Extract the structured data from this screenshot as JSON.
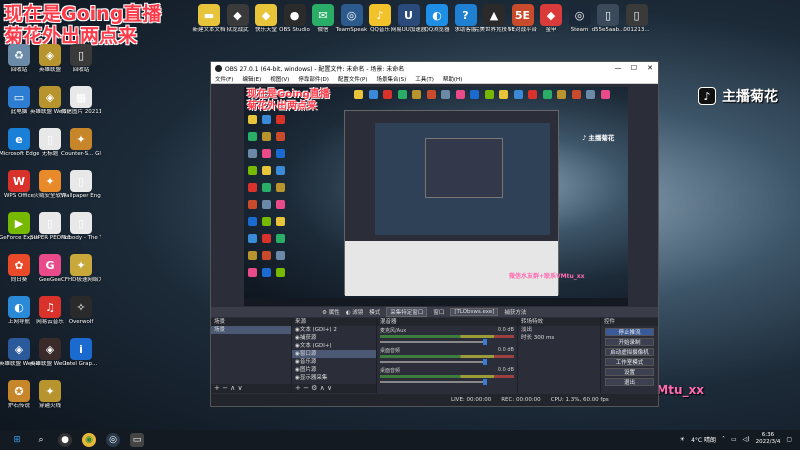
{
  "overlay": {
    "title_line1": "现在是Going直播",
    "title_line2": "菊花外出两点来",
    "tiktok_glyph": "♪",
    "streamer_name": "主播菊花",
    "wechat_text": "微信水友群+联系VMtu_xx"
  },
  "desktop_top_icons": [
    {
      "label": "新建文本文档",
      "color": "#e8c43a",
      "icon": "folder-icon"
    },
    {
      "label": "狱龙战武",
      "color": "#3a3a3a",
      "icon": "game-icon"
    },
    {
      "label": "快乐天堂",
      "color": "#e8c43a",
      "icon": "game-icon"
    },
    {
      "label": "OBS Studio",
      "color": "#2b2b2b",
      "icon": "obs-icon"
    },
    {
      "label": "微信",
      "color": "#2aae67",
      "icon": "wechat-icon"
    },
    {
      "label": "TeamSpeak",
      "color": "#2d5a8c",
      "icon": "teamspeak-icon"
    },
    {
      "label": "QQ音乐",
      "color": "#f2c22b",
      "icon": "qqmusic-icon"
    },
    {
      "label": "网易UU加速器",
      "color": "#2b4a7c",
      "icon": "uu-icon"
    },
    {
      "label": "QQ浏览器",
      "color": "#1f8fe5",
      "icon": "browser-icon"
    },
    {
      "label": "求助客服",
      "color": "#1f7fd0",
      "icon": "help-icon"
    },
    {
      "label": "完美世界竞技平台",
      "color": "#2a2a2a",
      "icon": "perfect-icon"
    },
    {
      "label": "5E对战平台",
      "color": "#c94b2c",
      "icon": "5e-icon"
    },
    {
      "label": "金甲",
      "color": "#d93a3a",
      "icon": "game-icon"
    },
    {
      "label": "Steam",
      "color": "#1b2838",
      "icon": "steam-icon"
    },
    {
      "label": "d55e5aab...",
      "color": "#3a4a5a",
      "icon": "file-icon"
    },
    {
      "label": "001213...",
      "color": "#3a3a3a",
      "icon": "file-icon"
    }
  ],
  "desktop_left_icons": [
    {
      "label": "回收站",
      "color": "#6a8aa8",
      "icon": "recycle-bin-icon"
    },
    {
      "label": "英雄联盟",
      "color": "#b8942e",
      "icon": "lol-icon"
    },
    {
      "label": "回收站",
      "color": "#3a3a3a",
      "icon": "file-icon"
    },
    {
      "label": "此电脑",
      "color": "#2d7dd2",
      "icon": "computer-icon"
    },
    {
      "label": "英雄联盟 WeGame版",
      "color": "#b8942e",
      "icon": "lol-icon"
    },
    {
      "label": "微信图片 2021121...",
      "color": "#e8e8e8",
      "icon": "image-icon"
    },
    {
      "label": "Microsoft Edge",
      "color": "#1a7fd6",
      "icon": "edge-icon"
    },
    {
      "label": "无标题",
      "color": "#e8e8e8",
      "icon": "file-icon"
    },
    {
      "label": "Counter-S... Global Off...",
      "color": "#c8862a",
      "icon": "csgo-icon"
    },
    {
      "label": "WPS Office",
      "color": "#d8322a",
      "icon": "wps-icon"
    },
    {
      "label": "火绒安全软件",
      "color": "#e88a2a",
      "icon": "huorong-icon"
    },
    {
      "label": "Wallpaper Engine:...",
      "color": "#e8e8e8",
      "icon": "file-icon"
    },
    {
      "label": "GeForce Experience",
      "color": "#76b900",
      "icon": "geforce-icon"
    },
    {
      "label": "SUPER PEOPLE CBT",
      "color": "#e8e8e8",
      "icon": "file-icon"
    },
    {
      "label": "Nobody - The Turna...",
      "color": "#e8e8e8",
      "icon": "file-icon"
    },
    {
      "label": "向日葵",
      "color": "#e84a2a",
      "icon": "sunflower-icon"
    },
    {
      "label": "GeeGee",
      "color": "#e84a8a",
      "icon": "geegee-icon"
    },
    {
      "label": "CFHD极速网络大区",
      "color": "#c8a83a",
      "icon": "cf-icon"
    },
    {
      "label": "上网导航",
      "color": "#2a8ad8",
      "icon": "nav-icon"
    },
    {
      "label": "网易云音乐",
      "color": "#d8322a",
      "icon": "netease-icon"
    },
    {
      "label": "Overwolf",
      "color": "#2a2a2a",
      "icon": "overwolf-icon"
    },
    {
      "label": "英雄联盟 WeGame版",
      "color": "#2a5a9a",
      "icon": "lol-icon"
    },
    {
      "label": "英雄联盟 WeGame版",
      "color": "#3a2a2a",
      "icon": "lol-icon"
    },
    {
      "label": "Intel Grap...",
      "color": "#1a6ad0",
      "icon": "intel-icon"
    },
    {
      "label": "炉石传说",
      "color": "#c8862a",
      "icon": "hearthstone-icon"
    },
    {
      "label": "穿越火线",
      "color": "#b8942e",
      "icon": "cf-icon"
    }
  ],
  "obs": {
    "title": "OBS 27.0.1 (64-bit, windows) - 配置文件: 未命名 - 场景: 未命名",
    "menu": [
      "文件(F)",
      "编辑(E)",
      "视图(V)",
      "停靠部件(D)",
      "配置文件(P)",
      "场景集合(S)",
      "工具(T)",
      "帮助(H)"
    ],
    "preview": {
      "title_line1": "现在是Going直播",
      "title_line2": "菊花外出两点来",
      "streamer_tag": "♪ 主播菊花",
      "wechat_text": "微信水友群+联系VMtu_xx"
    },
    "toolbar": {
      "properties": "属性",
      "filters": "滤镜",
      "mode_label": "模式",
      "mode_value": "采集特定窗口",
      "window_label": "窗口",
      "window_value": "[TLObsws.exe]",
      "capture_label": "捕获方法"
    },
    "scenes": {
      "header": "场景",
      "items": [
        "场景"
      ],
      "footer": "+ − ∧ ∨"
    },
    "sources": {
      "header": "来源",
      "items": [
        "文本 (GDI+) 2",
        "捕获源",
        "文本 (GDI+)",
        "窗口源",
        "音乐源",
        "图片源",
        "显示器采集"
      ],
      "active_index": 3,
      "footer": "+ − ⚙ ∧ ∨"
    },
    "mixer": {
      "header": "混音器",
      "tracks": [
        {
          "name": "麦克风/Aux",
          "db": "0.0 dB"
        },
        {
          "name": "桌面音频",
          "db": "0.0 dB"
        },
        {
          "name": "桌面音频",
          "db": "0.0 dB"
        }
      ]
    },
    "transitions": {
      "header": "转场特效",
      "type": "淡出",
      "duration_label": "时长",
      "duration_value": "300 ms"
    },
    "controls": {
      "header": "控件",
      "buttons": [
        "停止推流",
        "开始录制",
        "启动虚拟摄像机",
        "工作室模式",
        "设置",
        "退出"
      ]
    },
    "status": {
      "live": "LIVE: 00:00:00",
      "rec": "REC: 00:00:00",
      "cpu": "CPU: 1.3%, 60.00 fps"
    }
  },
  "taskbar": {
    "pinned_icons": [
      "windows-icon",
      "search-icon",
      "obs-icon",
      "chrome-icon",
      "steam-icon",
      "file-explorer-icon"
    ],
    "weather": "4°C 晴朗",
    "time": "6:36",
    "date": "2022/3/4"
  }
}
